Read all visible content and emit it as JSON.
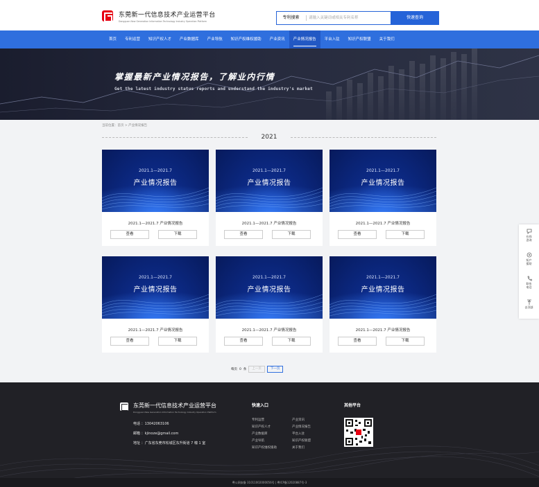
{
  "header": {
    "brand_title": "东莞新一代信息技术产业运营平台",
    "brand_subtitle": "Dongguan New Generation Information Technology Industry Operation Platform",
    "search_category": "专利搜索",
    "search_placeholder": "请输入关键词或相关专利名称",
    "search_button": "快速查询"
  },
  "nav": {
    "items": [
      "首页",
      "专利运营",
      "知识产权人才",
      "产业数据库",
      "产业导航",
      "知识产权维权援助",
      "产业资讯",
      "产业情况报告",
      "平台入驻",
      "知识产权联盟",
      "关于我们"
    ],
    "active_index": 7
  },
  "banner": {
    "title": "掌握最新产业情况报告，了解业内行情",
    "subtitle": "Get the latest industry status reports and understand the industry's market"
  },
  "breadcrumb": "当前位置：首页 > 产业情况报告",
  "year": "2021",
  "cards": [
    {
      "period": "2021.1—2021.7",
      "heading": "产业情况报告",
      "title": "2021.1—2021.7 产业情况报告",
      "view": "查看",
      "download": "下载"
    },
    {
      "period": "2021.1—2021.7",
      "heading": "产业情况报告",
      "title": "2021.1—2021.7 产业情况报告",
      "view": "查看",
      "download": "下载"
    },
    {
      "period": "2021.1—2021.7",
      "heading": "产业情况报告",
      "title": "2021.1—2021.7 产业情况报告",
      "view": "查看",
      "download": "下载"
    },
    {
      "period": "2021.1—2021.7",
      "heading": "产业情况报告",
      "title": "2021.1—2021.7 产业情况报告",
      "view": "查看",
      "download": "下载"
    },
    {
      "period": "2021.1—2021.7",
      "heading": "产业情况报告",
      "title": "2021.1—2021.7 产业情况报告",
      "view": "查看",
      "download": "下载"
    },
    {
      "period": "2021.1—2021.7",
      "heading": "产业情况报告",
      "title": "2021.1—2021.7 产业情况报告",
      "view": "查看",
      "download": "下载"
    }
  ],
  "pagination": {
    "per_page_label": "每页",
    "per_page_value": "0",
    "unit": "条",
    "prev": "上一页",
    "next": "下一页"
  },
  "side_bar": [
    {
      "icon": "chat-icon",
      "label": "在线\n咨询"
    },
    {
      "icon": "help-icon",
      "label": "知产\n援助"
    },
    {
      "icon": "phone-icon",
      "label": "联系\n电话"
    },
    {
      "icon": "arrow-up-icon",
      "label": "去顶部"
    }
  ],
  "footer": {
    "brand_title": "东莞新一代信息技术产业运营平台",
    "brand_subtitle": "Dongguan New Generation Information Technology Industry Operation Platform",
    "phone": "电话 ：13042063106",
    "email": "邮箱 ：kjinoze@gmail.com",
    "address": "地址 ：广东省东莞市松城区东升街道 7 幢 1 室",
    "quick_entry_title": "快速入口",
    "quick_links": [
      "专利运营",
      "产业资讯",
      "知识产权人才",
      "产业情况报告",
      "产业数据库",
      "平台入驻",
      "产业导航",
      "知识产权联盟",
      "知识产权维权援助",
      "关于我们"
    ],
    "other_title": "其他平台",
    "copyright": "粤公网安备 31011002000056号 | 粤ICP备12020887号-3"
  },
  "colors": {
    "brand_red": "#e60012",
    "nav_blue": "#2f6fde",
    "nav_active": "#2258c4",
    "footer_bg": "#212126"
  }
}
